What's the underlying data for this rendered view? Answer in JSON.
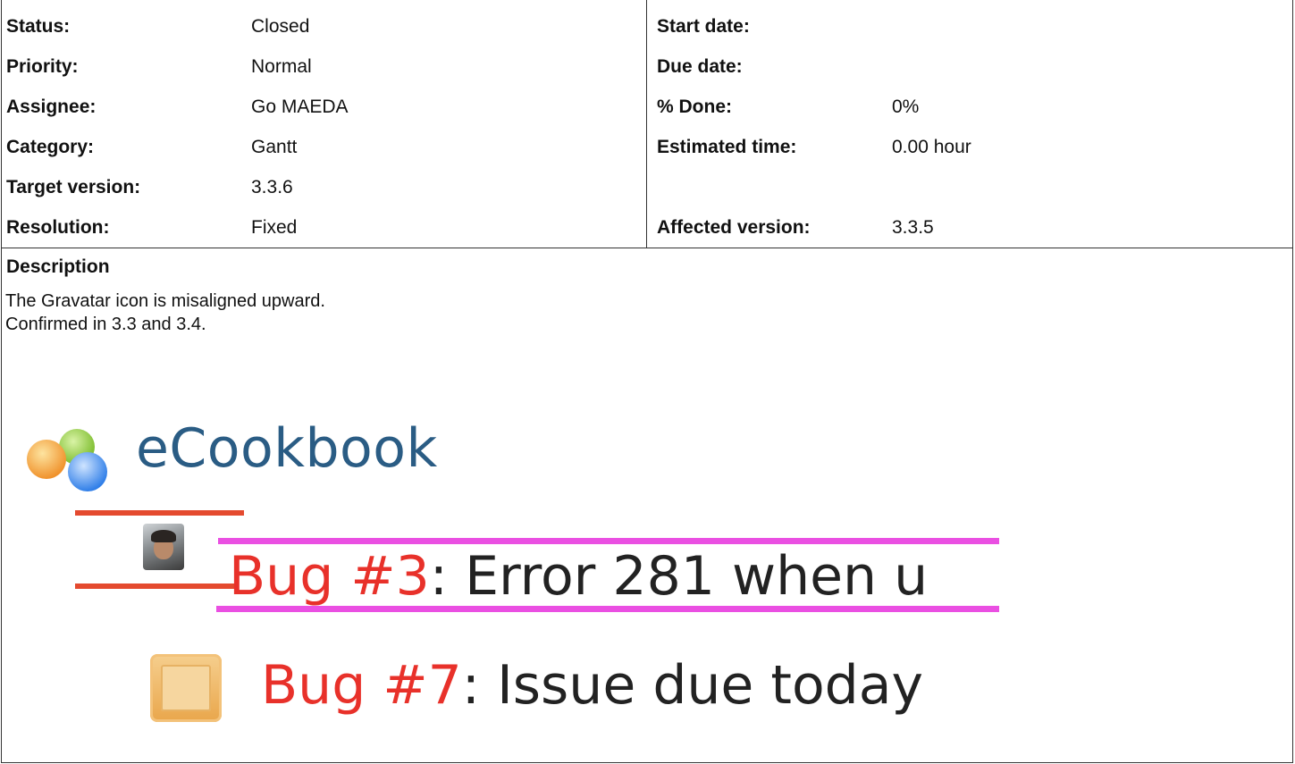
{
  "attributes": {
    "left": [
      {
        "label": "Status:",
        "value": "Closed"
      },
      {
        "label": "Priority:",
        "value": "Normal"
      },
      {
        "label": "Assignee:",
        "value": "Go MAEDA"
      },
      {
        "label": "Category:",
        "value": "Gantt"
      },
      {
        "label": "Target version:",
        "value": "3.3.6"
      },
      {
        "label": "Resolution:",
        "value": "Fixed"
      }
    ],
    "right": [
      {
        "label": "Start date:",
        "value": ""
      },
      {
        "label": "Due date:",
        "value": ""
      },
      {
        "label": "% Done:",
        "value": "0%"
      },
      {
        "label": "Estimated time:",
        "value": "0.00 hour"
      },
      {
        "label": "Affected version:",
        "value": "3.3.5"
      }
    ]
  },
  "description": {
    "title": "Description",
    "lines": [
      "The Gravatar icon is misaligned upward.",
      "Confirmed in 3.3 and 3.4."
    ]
  },
  "screenshot": {
    "project_name": "eCookbook",
    "issue1_id": "Bug #3",
    "issue1_rest": ": Error 281 when u",
    "issue2_id": "Bug #7",
    "issue2_rest": ": Issue due today"
  },
  "colors": {
    "bug_id": "#e8312a",
    "misalign_marker": "#e44a2f",
    "text_box_marker": "#ea4fe2",
    "logo_text": "#2a5c84"
  },
  "icons": [
    "project-logo-icon",
    "gravatar-avatar-icon",
    "calendar-icon"
  ]
}
